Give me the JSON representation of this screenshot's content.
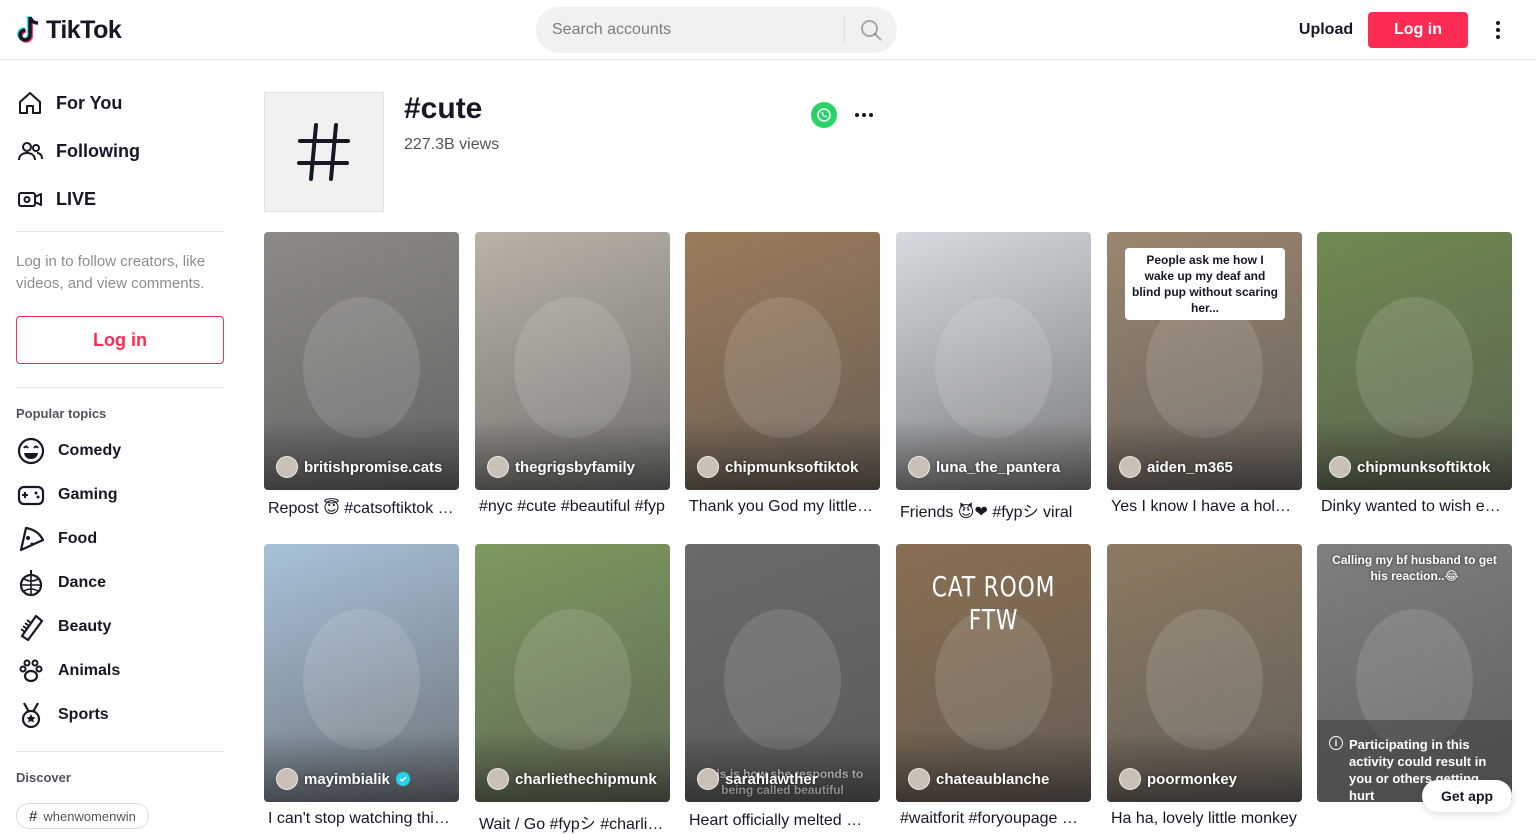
{
  "header": {
    "logo_text": "TikTok",
    "search_placeholder": "Search accounts",
    "upload_label": "Upload",
    "login_label": "Log in"
  },
  "sidebar": {
    "nav": [
      {
        "label": "For You",
        "icon": "home-icon"
      },
      {
        "label": "Following",
        "icon": "users-icon"
      },
      {
        "label": "LIVE",
        "icon": "live-icon"
      }
    ],
    "login_prompt": "Log in to follow creators, like videos, and view comments.",
    "login_button": "Log in",
    "popular_heading": "Popular topics",
    "topics": [
      {
        "label": "Comedy",
        "icon": "smile-icon"
      },
      {
        "label": "Gaming",
        "icon": "gamepad-icon"
      },
      {
        "label": "Food",
        "icon": "pizza-icon"
      },
      {
        "label": "Dance",
        "icon": "disco-ball-icon"
      },
      {
        "label": "Beauty",
        "icon": "comb-icon"
      },
      {
        "label": "Animals",
        "icon": "paw-icon"
      },
      {
        "label": "Sports",
        "icon": "medal-icon"
      }
    ],
    "discover_heading": "Discover",
    "discover_chip": "whenwomenwin"
  },
  "tag": {
    "title": "#cute",
    "views": "227.3B views"
  },
  "videos": [
    {
      "author": "britishpromise.cats",
      "caption": "Repost 😇 #catsoftiktok #cute #fyp",
      "bg": "#8d8a86",
      "verified": false
    },
    {
      "author": "thegrigsbyfamily",
      "caption": "#nyc #cute #beautiful #fyp",
      "bg": "#b9b3a8",
      "verified": false
    },
    {
      "author": "chipmunksoftiktok",
      "caption": "Thank you God my little friend",
      "bg": "#9b7b5a",
      "verified": false
    },
    {
      "author": "luna_the_pantera",
      "caption": "Friends 😈❤ #fypシ   viral",
      "bg": "#d6dbe0",
      "verified": false
    },
    {
      "author": "aiden_m365",
      "caption": "Yes I know I have a hole in my wall",
      "bg": "#9a8670",
      "verified": false,
      "overlay": "People ask me how I wake up my deaf and blind pup without scaring her..."
    },
    {
      "author": "chipmunksoftiktok",
      "caption": "Dinky wanted to wish everyone",
      "bg": "#6f8a4f",
      "verified": false
    },
    {
      "author": "mayimbialik",
      "caption": "I can't stop watching this...",
      "bg": "#a9c2d8",
      "verified": true
    },
    {
      "author": "charliethechipmunk",
      "caption": "Wait / Go #fypシ #charliethechipmunk",
      "bg": "#7d9a5d",
      "verified": false
    },
    {
      "author": "sarahlawther",
      "caption": "Heart officially melted ❤ #pitbull",
      "bg": "#6c6a68",
      "verified": false,
      "overlay": "This is how she responds to being called beautiful"
    },
    {
      "author": "chateaublanche",
      "caption": "#waitforit #foryoupage #cat",
      "bg": "#8a6f52",
      "verified": false,
      "overlay": "CAT ROOM FTW"
    },
    {
      "author": "poormonkey",
      "caption": "Ha ha, lovely little monkey",
      "bg": "#8c7a62",
      "verified": false
    },
    {
      "author": "",
      "caption": "",
      "bg": "#7f7f80",
      "verified": false,
      "overlay": "Calling my bf husband to get his reaction..😂",
      "warning": "Participating in this activity could result in you or others getting hurt"
    }
  ],
  "get_app_label": "Get app",
  "colors": {
    "brand": "#fe2c55",
    "text": "#161823",
    "whatsapp": "#25d366"
  }
}
